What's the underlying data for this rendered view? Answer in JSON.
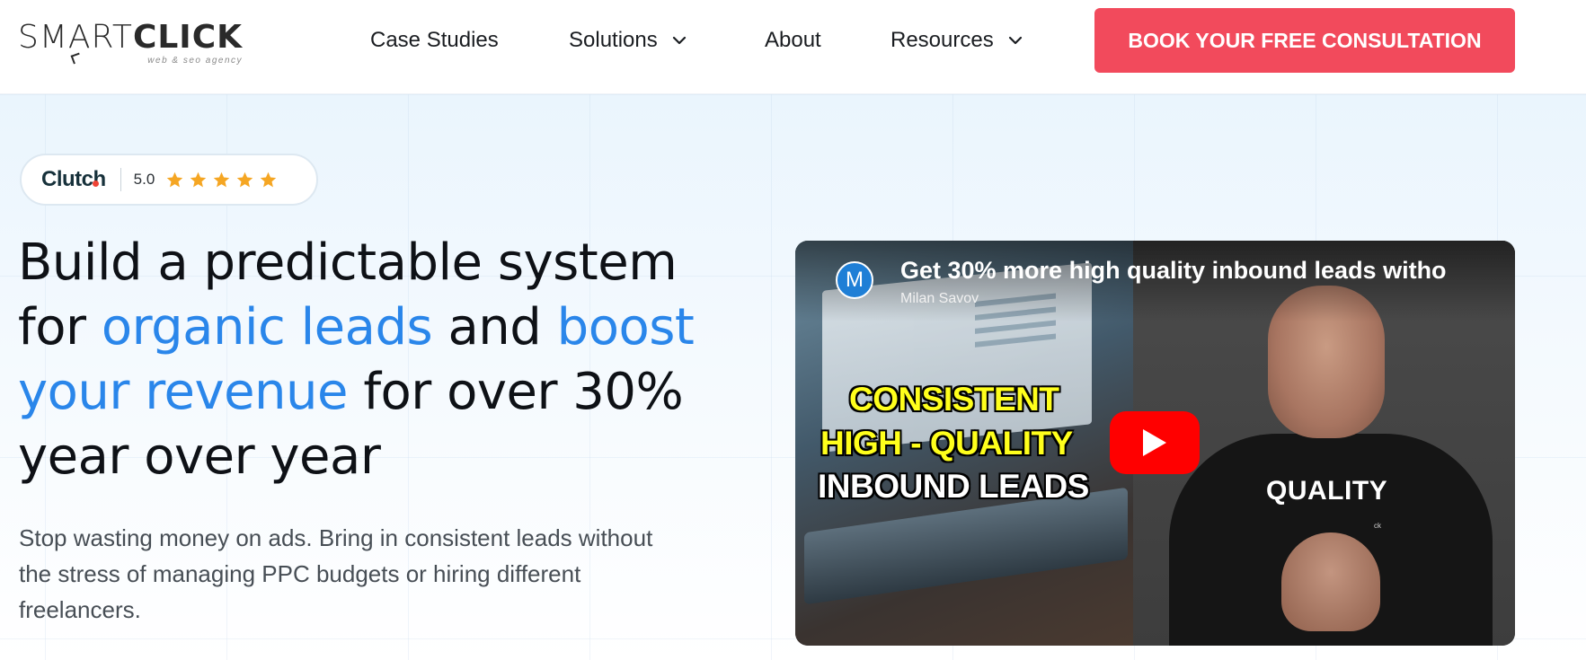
{
  "header": {
    "logo": {
      "smart": "SMART",
      "click": "CLICK",
      "tagline": "web & seo agency"
    },
    "nav": [
      {
        "label": "Case Studies",
        "dropdown": false
      },
      {
        "label": "Solutions",
        "dropdown": true
      },
      {
        "label": "About",
        "dropdown": false
      },
      {
        "label": "Resources",
        "dropdown": true
      }
    ],
    "cta_label": "BOOK YOUR FREE CONSULTATION"
  },
  "hero": {
    "clutch": {
      "logo": "Clutch",
      "rating": "5.0",
      "stars": 5
    },
    "headline": {
      "part1": "Build a predictable system for",
      "highlight1": "organic leads",
      "part2": "and",
      "highlight2": "boost your revenue",
      "part3": "for over 30% year over year"
    },
    "subtext": "Stop wasting money on ads. Bring in consistent leads without the stress of managing PPC budgets or hiring different freelancers.",
    "video": {
      "channel_initial": "M",
      "title": "Get 30% more high quality inbound leads witho",
      "channel": "Milan Savov",
      "overlay_line1": "CONSISTENT",
      "overlay_line2": "HIGH - QUALITY",
      "overlay_line3": "INBOUND LEADS",
      "shirt_text": "QUALITY",
      "shirt_mark": "ck"
    }
  },
  "colors": {
    "accent_blue": "#2a86ea",
    "cta_red": "#f24a5c",
    "star": "#f5a623",
    "youtube_red": "#ff0000"
  },
  "icons": [
    "chevron-down-icon",
    "star-icon",
    "play-icon"
  ]
}
